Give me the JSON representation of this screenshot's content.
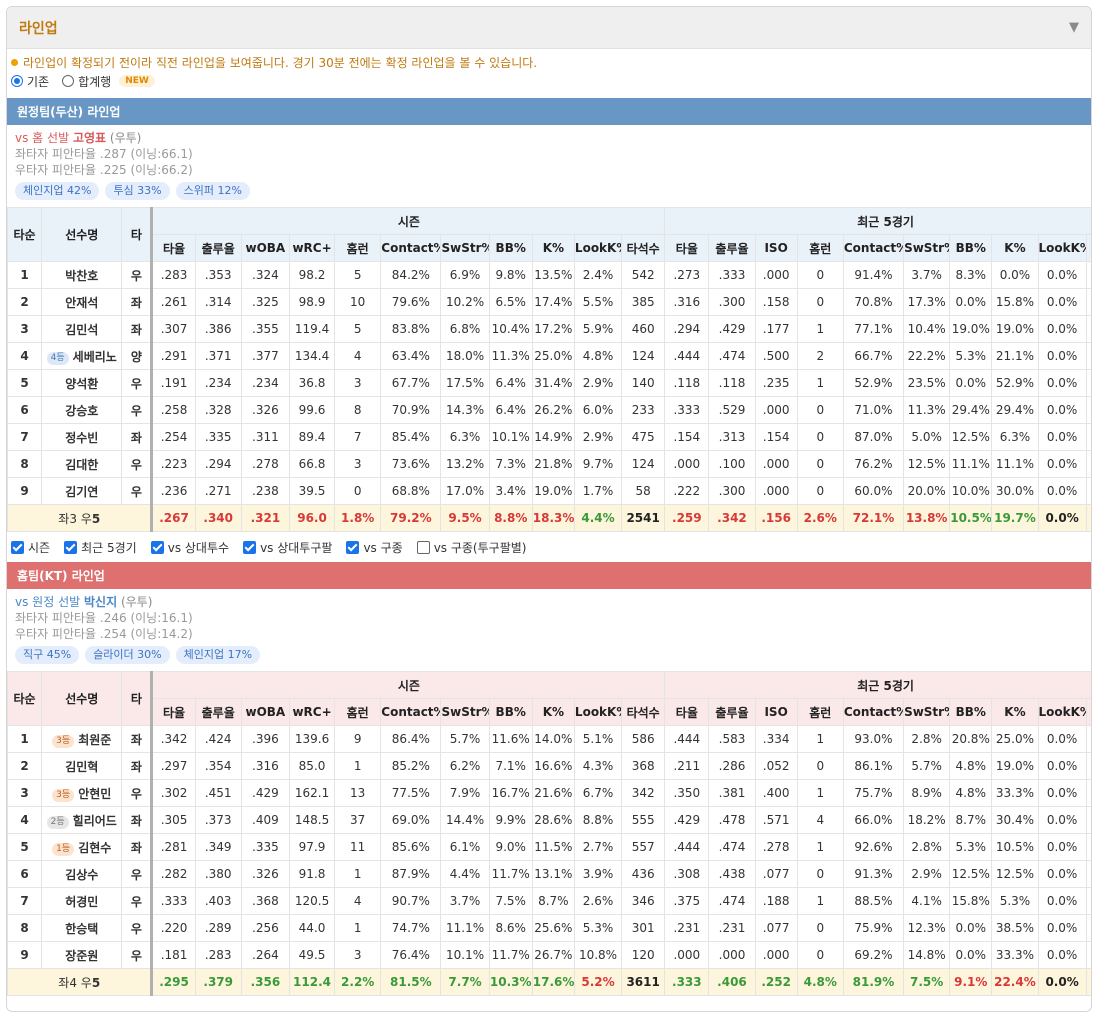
{
  "header": {
    "title": "라인업",
    "toggle_icon": "triangle-down-icon"
  },
  "notice": "라인업이 확정되기 전이라 직전 라인업을 보여줍니다. 경기 30분 전에는 확정 라인업을 볼 수 있습니다.",
  "view_options": {
    "basic": "기존",
    "combined": "합계행",
    "new_badge": "NEW",
    "selected": "기존"
  },
  "filters": [
    {
      "label": "시즌",
      "checked": true
    },
    {
      "label": "최근 5경기",
      "checked": true
    },
    {
      "label": "vs 상대투수",
      "checked": true
    },
    {
      "label": "vs 상대투구팔",
      "checked": true
    },
    {
      "label": "vs 구종",
      "checked": true
    },
    {
      "label": "vs 구종(투구팔별)",
      "checked": false
    }
  ],
  "table_headers": {
    "order": "타순",
    "name": "선수명",
    "hand": "타",
    "season": "시즌",
    "recent": "최근 5경기",
    "season_cols": [
      "타율",
      "출루율",
      "wOBA",
      "wRC+",
      "홈런",
      "Contact%",
      "SwStr%",
      "BB%",
      "K%",
      "LookK%",
      "타석수"
    ],
    "recent_cols": [
      "타율",
      "출루율",
      "ISO",
      "홈런",
      "Contact%",
      "SwStr%",
      "BB%",
      "K%",
      "LookK%"
    ]
  },
  "away": {
    "title": "원정팀(두산) 라인업",
    "vs_prefix": "vs 홈 선발",
    "pitcher": "고영표",
    "pitcher_hand": "(우투)",
    "lhb": "좌타자 피안타율 .287 (이닝:66.1)",
    "rhb": "우타자 피안타율 .225 (이닝:66.2)",
    "pitches": [
      "체인지업 42%",
      "투심 33%",
      "스위퍼 12%"
    ],
    "rows": [
      {
        "o": "1",
        "badge": "",
        "name": "박찬호",
        "h": "우",
        "s": [
          ".283",
          ".353",
          ".324",
          "98.2",
          "5",
          "84.2%",
          "6.9%",
          "9.8%",
          "13.5%",
          "2.4%",
          "542"
        ],
        "r": [
          ".273",
          ".333",
          ".000",
          "0",
          "91.4%",
          "3.7%",
          "8.3%",
          "0.0%",
          "0.0%"
        ]
      },
      {
        "o": "2",
        "badge": "",
        "name": "안재석",
        "h": "좌",
        "s": [
          ".261",
          ".314",
          ".325",
          "98.9",
          "10",
          "79.6%",
          "10.2%",
          "6.5%",
          "17.4%",
          "5.5%",
          "385"
        ],
        "r": [
          ".316",
          ".300",
          ".158",
          "0",
          "70.8%",
          "17.3%",
          "0.0%",
          "15.8%",
          "0.0%"
        ]
      },
      {
        "o": "3",
        "badge": "",
        "name": "김민석",
        "h": "좌",
        "s": [
          ".307",
          ".386",
          ".355",
          "119.4",
          "5",
          "83.8%",
          "6.8%",
          "10.4%",
          "17.2%",
          "5.9%",
          "460"
        ],
        "r": [
          ".294",
          ".429",
          ".177",
          "1",
          "77.1%",
          "10.4%",
          "19.0%",
          "19.0%",
          "0.0%"
        ]
      },
      {
        "o": "4",
        "badge": "4등",
        "bc": "b-blue",
        "name": "세베리노",
        "h": "양",
        "s": [
          ".291",
          ".371",
          ".377",
          "134.4",
          "4",
          "63.4%",
          "18.0%",
          "11.3%",
          "25.0%",
          "4.8%",
          "124"
        ],
        "r": [
          ".444",
          ".474",
          ".500",
          "2",
          "66.7%",
          "22.2%",
          "5.3%",
          "21.1%",
          "0.0%"
        ]
      },
      {
        "o": "5",
        "badge": "",
        "name": "양석환",
        "h": "우",
        "s": [
          ".191",
          ".234",
          ".234",
          "36.8",
          "3",
          "67.7%",
          "17.5%",
          "6.4%",
          "31.4%",
          "2.9%",
          "140"
        ],
        "r": [
          ".118",
          ".118",
          ".235",
          "1",
          "52.9%",
          "23.5%",
          "0.0%",
          "52.9%",
          "0.0%"
        ]
      },
      {
        "o": "6",
        "badge": "",
        "name": "강승호",
        "h": "우",
        "s": [
          ".258",
          ".328",
          ".326",
          "99.6",
          "8",
          "70.9%",
          "14.3%",
          "6.4%",
          "26.2%",
          "6.0%",
          "233"
        ],
        "r": [
          ".333",
          ".529",
          ".000",
          "0",
          "71.0%",
          "11.3%",
          "29.4%",
          "29.4%",
          "0.0%"
        ]
      },
      {
        "o": "7",
        "badge": "",
        "name": "정수빈",
        "h": "좌",
        "s": [
          ".254",
          ".335",
          ".311",
          "89.4",
          "7",
          "85.4%",
          "6.3%",
          "10.1%",
          "14.9%",
          "2.9%",
          "475"
        ],
        "r": [
          ".154",
          ".313",
          ".154",
          "0",
          "87.0%",
          "5.0%",
          "12.5%",
          "6.3%",
          "0.0%"
        ]
      },
      {
        "o": "8",
        "badge": "",
        "name": "김대한",
        "h": "우",
        "s": [
          ".223",
          ".294",
          ".278",
          "66.8",
          "3",
          "73.6%",
          "13.2%",
          "7.3%",
          "21.8%",
          "9.7%",
          "124"
        ],
        "r": [
          ".000",
          ".100",
          ".000",
          "0",
          "76.2%",
          "12.5%",
          "11.1%",
          "11.1%",
          "0.0%"
        ]
      },
      {
        "o": "9",
        "badge": "",
        "name": "김기연",
        "h": "우",
        "s": [
          ".236",
          ".271",
          ".238",
          "39.5",
          "0",
          "68.8%",
          "17.0%",
          "3.4%",
          "19.0%",
          "1.7%",
          "58"
        ],
        "r": [
          ".222",
          ".300",
          ".000",
          "0",
          "60.0%",
          "20.0%",
          "10.0%",
          "30.0%",
          "0.0%"
        ]
      }
    ],
    "total": {
      "label_l": "좌3 우",
      "label_n": "5",
      "s": [
        [
          ".267",
          "r"
        ],
        [
          ".340",
          "r"
        ],
        [
          ".321",
          "r"
        ],
        [
          "96.0",
          "r"
        ],
        [
          "1.8%",
          "r"
        ],
        [
          "79.2%",
          "r"
        ],
        [
          "9.5%",
          "r"
        ],
        [
          "8.8%",
          "r"
        ],
        [
          "18.3%",
          "r"
        ],
        [
          "4.4%",
          "g"
        ],
        [
          "2541",
          "k"
        ]
      ],
      "r": [
        [
          ".259",
          "r"
        ],
        [
          ".342",
          "r"
        ],
        [
          ".156",
          "r"
        ],
        [
          "2.6%",
          "r"
        ],
        [
          "72.1%",
          "r"
        ],
        [
          "13.8%",
          "r"
        ],
        [
          "10.5%",
          "g"
        ],
        [
          "19.7%",
          "g"
        ],
        [
          "0.0%",
          "k"
        ]
      ]
    }
  },
  "home": {
    "title": "홈팀(KT) 라인업",
    "vs_prefix": "vs 원정 선발",
    "pitcher": "박신지",
    "pitcher_hand": "(우투)",
    "lhb": "좌타자 피안타율 .246 (이닝:16.1)",
    "rhb": "우타자 피안타율 .254 (이닝:14.2)",
    "pitches": [
      "직구 45%",
      "슬라이더 30%",
      "체인지업 17%"
    ],
    "rows": [
      {
        "o": "1",
        "badge": "3등",
        "bc": "b-orange",
        "name": "최원준",
        "h": "좌",
        "s": [
          ".342",
          ".424",
          ".396",
          "139.6",
          "9",
          "86.4%",
          "5.7%",
          "11.6%",
          "14.0%",
          "5.1%",
          "586"
        ],
        "r": [
          ".444",
          ".583",
          ".334",
          "1",
          "93.0%",
          "2.8%",
          "20.8%",
          "25.0%",
          "0.0%"
        ]
      },
      {
        "o": "2",
        "badge": "",
        "name": "김민혁",
        "h": "좌",
        "s": [
          ".297",
          ".354",
          ".316",
          "85.0",
          "1",
          "85.2%",
          "6.2%",
          "7.1%",
          "16.6%",
          "4.3%",
          "368"
        ],
        "r": [
          ".211",
          ".286",
          ".052",
          "0",
          "86.1%",
          "5.7%",
          "4.8%",
          "19.0%",
          "0.0%"
        ]
      },
      {
        "o": "3",
        "badge": "3등",
        "bc": "b-orange",
        "name": "안현민",
        "h": "우",
        "s": [
          ".302",
          ".451",
          ".429",
          "162.1",
          "13",
          "77.5%",
          "7.9%",
          "16.7%",
          "21.6%",
          "6.7%",
          "342"
        ],
        "r": [
          ".350",
          ".381",
          ".400",
          "1",
          "75.7%",
          "8.9%",
          "4.8%",
          "33.3%",
          "0.0%"
        ]
      },
      {
        "o": "4",
        "badge": "2등",
        "bc": "b-grey",
        "name": "힐리어드",
        "h": "좌",
        "s": [
          ".305",
          ".373",
          ".409",
          "148.5",
          "37",
          "69.0%",
          "14.4%",
          "9.9%",
          "28.6%",
          "8.8%",
          "555"
        ],
        "r": [
          ".429",
          ".478",
          ".571",
          "4",
          "66.0%",
          "18.2%",
          "8.7%",
          "30.4%",
          "0.0%"
        ]
      },
      {
        "o": "5",
        "badge": "1등",
        "bc": "b-orange",
        "name": "김현수",
        "h": "좌",
        "s": [
          ".281",
          ".349",
          ".335",
          "97.9",
          "11",
          "85.6%",
          "6.1%",
          "9.0%",
          "11.5%",
          "2.7%",
          "557"
        ],
        "r": [
          ".444",
          ".474",
          ".278",
          "1",
          "92.6%",
          "2.8%",
          "5.3%",
          "10.5%",
          "0.0%"
        ]
      },
      {
        "o": "6",
        "badge": "",
        "name": "김상수",
        "h": "우",
        "s": [
          ".282",
          ".380",
          ".326",
          "91.8",
          "1",
          "87.9%",
          "4.4%",
          "11.7%",
          "13.1%",
          "3.9%",
          "436"
        ],
        "r": [
          ".308",
          ".438",
          ".077",
          "0",
          "91.3%",
          "2.9%",
          "12.5%",
          "12.5%",
          "0.0%"
        ]
      },
      {
        "o": "7",
        "badge": "",
        "name": "허경민",
        "h": "우",
        "s": [
          ".333",
          ".403",
          ".368",
          "120.5",
          "4",
          "90.7%",
          "3.7%",
          "7.5%",
          "8.7%",
          "2.6%",
          "346"
        ],
        "r": [
          ".375",
          ".474",
          ".188",
          "1",
          "88.5%",
          "4.1%",
          "15.8%",
          "5.3%",
          "0.0%"
        ]
      },
      {
        "o": "8",
        "badge": "",
        "name": "한승택",
        "h": "우",
        "s": [
          ".220",
          ".289",
          ".256",
          "44.0",
          "1",
          "74.7%",
          "11.1%",
          "8.6%",
          "25.6%",
          "5.3%",
          "301"
        ],
        "r": [
          ".231",
          ".231",
          ".077",
          "0",
          "75.9%",
          "12.3%",
          "0.0%",
          "38.5%",
          "0.0%"
        ]
      },
      {
        "o": "9",
        "badge": "",
        "name": "장준원",
        "h": "우",
        "s": [
          ".181",
          ".283",
          ".264",
          "49.5",
          "3",
          "76.4%",
          "10.1%",
          "11.7%",
          "26.7%",
          "10.8%",
          "120"
        ],
        "r": [
          ".000",
          ".000",
          ".000",
          "0",
          "69.2%",
          "14.8%",
          "0.0%",
          "33.3%",
          "0.0%"
        ]
      }
    ],
    "total": {
      "label_l": "좌4 우",
      "label_n": "5",
      "s": [
        [
          ".295",
          "g"
        ],
        [
          ".379",
          "g"
        ],
        [
          ".356",
          "g"
        ],
        [
          "112.4",
          "g"
        ],
        [
          "2.2%",
          "g"
        ],
        [
          "81.5%",
          "g"
        ],
        [
          "7.7%",
          "g"
        ],
        [
          "10.3%",
          "g"
        ],
        [
          "17.6%",
          "g"
        ],
        [
          "5.2%",
          "r"
        ],
        [
          "3611",
          "k"
        ]
      ],
      "r": [
        [
          ".333",
          "g"
        ],
        [
          ".406",
          "g"
        ],
        [
          ".252",
          "g"
        ],
        [
          "4.8%",
          "g"
        ],
        [
          "81.9%",
          "g"
        ],
        [
          "7.5%",
          "g"
        ],
        [
          "9.1%",
          "r"
        ],
        [
          "22.4%",
          "r"
        ],
        [
          "0.0%",
          "k"
        ]
      ]
    }
  },
  "colors": {
    "accent": "#c07a10",
    "away_bar": "#6897c5",
    "home_bar": "#de7070",
    "good": "#3a9a3a",
    "bad": "#d83838"
  }
}
